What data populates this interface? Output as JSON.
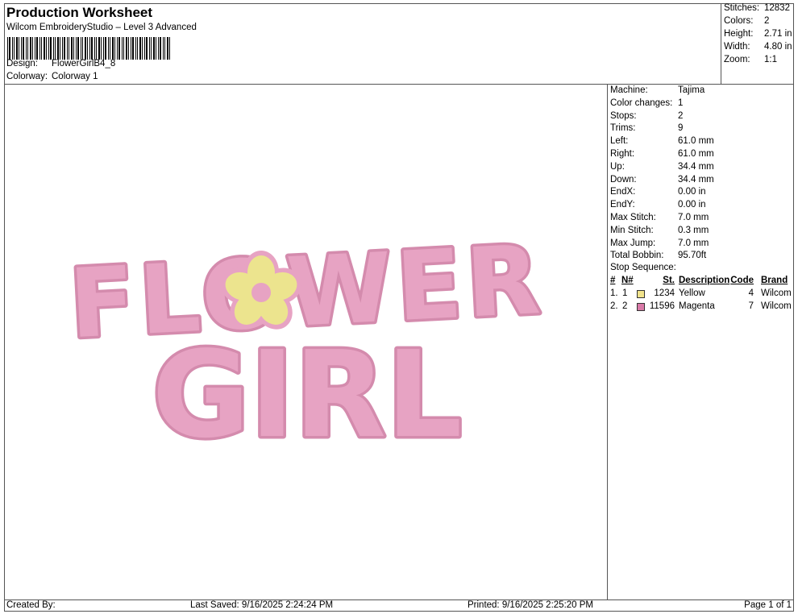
{
  "header": {
    "title": "Production Worksheet",
    "subtitle": "Wilcom EmbroideryStudio – Level 3 Advanced",
    "design_label": "Design:",
    "design_value": "FlowerGirlB4_8",
    "colorway_label": "Colorway:",
    "colorway_value": "Colorway 1"
  },
  "stats": [
    {
      "label": "Stitches:",
      "value": "12832"
    },
    {
      "label": "Colors:",
      "value": "2"
    },
    {
      "label": "Height:",
      "value": "2.71 in"
    },
    {
      "label": "Width:",
      "value": "4.80 in"
    },
    {
      "label": "Zoom:",
      "value": "1:1"
    }
  ],
  "machine_info": [
    {
      "label": "Machine:",
      "value": "Tajima"
    },
    {
      "label": "Color changes:",
      "value": "1"
    },
    {
      "label": "Stops:",
      "value": "2"
    },
    {
      "label": "Trims:",
      "value": "9"
    },
    {
      "label": "Left:",
      "value": "61.0 mm"
    },
    {
      "label": "Right:",
      "value": "61.0 mm"
    },
    {
      "label": "Up:",
      "value": "34.4 mm"
    },
    {
      "label": "Down:",
      "value": "34.4 mm"
    },
    {
      "label": "EndX:",
      "value": "0.00 in"
    },
    {
      "label": "EndY:",
      "value": "0.00 in"
    },
    {
      "label": "Max Stitch:",
      "value": "7.0 mm"
    },
    {
      "label": "Min Stitch:",
      "value": "0.3 mm"
    },
    {
      "label": "Max Jump:",
      "value": "7.0 mm"
    },
    {
      "label": "Total Bobbin:",
      "value": "95.70ft"
    }
  ],
  "stop_sequence": {
    "title": "Stop Sequence:",
    "headers": {
      "num": "#",
      "n": "N#",
      "st": "St.",
      "desc": "Description",
      "code": "Code",
      "brand": "Brand"
    },
    "rows": [
      {
        "num": "1.",
        "n": "1",
        "color": "#f1e38c",
        "st": "1234",
        "desc": "Yellow",
        "code": "4",
        "brand": "Wilcom"
      },
      {
        "num": "2.",
        "n": "2",
        "color": "#d97aa8",
        "st": "11596",
        "desc": "Magenta",
        "code": "7",
        "brand": "Wilcom"
      }
    ]
  },
  "design_preview": {
    "line1": "FLOWER",
    "line2": "GIRL",
    "text_color": "#e7a3c3",
    "outline_color": "#d48bad",
    "flower_color": "#ece48e"
  },
  "footer": {
    "created": "Created By:",
    "saved": "Last Saved: 9/16/2025 2:24:24 PM",
    "printed": "Printed: 9/16/2025 2:25:20 PM",
    "page": "Page 1 of 1"
  }
}
